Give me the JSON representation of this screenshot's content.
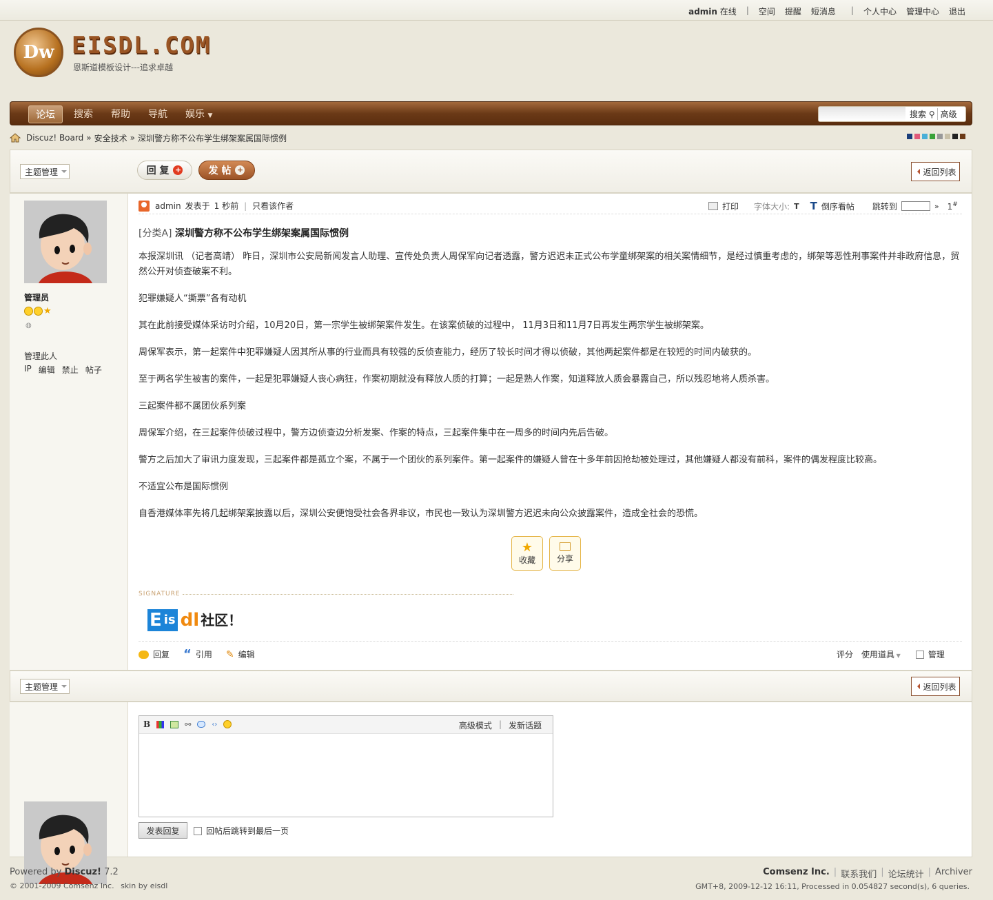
{
  "topbar": {
    "user": "admin",
    "status": "在线",
    "links": [
      "空间",
      "提醒",
      "短消息"
    ],
    "links2": [
      "个人中心",
      "管理中心",
      "退出"
    ]
  },
  "header": {
    "logo_mark": "Dw",
    "logo_text": "EISDL.COM",
    "slogan": "恩斯道模板设计---追求卓越"
  },
  "nav": {
    "items": [
      "论坛",
      "搜索",
      "帮助",
      "导航",
      "娱乐"
    ],
    "search_button": "搜索",
    "advanced": "高级"
  },
  "breadcrumb": {
    "items": [
      "Discuz! Board",
      "安全技术",
      "深圳警方称不公布学生绑架案属国际惯例"
    ]
  },
  "swatches": [
    "#1a3e7a",
    "#e05a7a",
    "#4ab0d8",
    "#3aa33a",
    "#999999",
    "#c8c0a8",
    "#222222",
    "#6b3a17"
  ],
  "toolbar": {
    "topic_manage": "主题管理",
    "reply": "回 复",
    "new_post": "发 帖",
    "back": "返回列表"
  },
  "author": {
    "role": "管理员",
    "manage_label": "管理此人",
    "manage_links": [
      "IP",
      "编辑",
      "禁止",
      "帖子"
    ]
  },
  "post": {
    "author": "admin",
    "posted": "发表于",
    "time": "1 秒前",
    "only_author": "只看该作者",
    "print": "打印",
    "font_size": "字体大小:",
    "reverse": "倒序看帖",
    "jump": "跳转到",
    "floor": "1",
    "floor_mark": "#",
    "category": "[分类A]",
    "title": "深圳警方称不公布学生绑架案属国际惯例",
    "paragraphs": [
      "本报深圳讯 （记者高靖） 昨日，深圳市公安局新闻发言人助理、宣传处负责人周保军向记者透露，警方迟迟未正式公布学童绑架案的相关案情细节，是经过慎重考虑的，绑架等恶性刑事案件并非政府信息，贸然公开对侦查破案不利。",
      "犯罪嫌疑人“撕票”各有动机",
      "其在此前接受媒体采访时介绍，10月20日，第一宗学生被绑架案件发生。在该案侦破的过程中， 11月3日和11月7日再发生两宗学生被绑架案。",
      "周保军表示，第一起案件中犯罪嫌疑人因其所从事的行业而具有较强的反侦查能力，经历了较长时间才得以侦破，其他两起案件都是在较短的时间内破获的。",
      "至于两名学生被害的案件，一起是犯罪嫌疑人丧心病狂，作案初期就没有释放人质的打算；一起是熟人作案，知道释放人质会暴露自己，所以残忍地将人质杀害。",
      "三起案件都不属团伙系列案",
      "周保军介绍，在三起案件侦破过程中，警方边侦查边分析发案、作案的特点，三起案件集中在一周多的时间内先后告破。",
      "警方之后加大了审讯力度发现，三起案件都是孤立个案，不属于一个团伙的系列案件。第一起案件的嫌疑人曾在十多年前因抢劫被处理过，其他嫌疑人都没有前科，案件的偶发程度比较高。",
      "不适宜公布是国际惯例",
      "自香港媒体率先将几起绑架案披露以后，深圳公安便饱受社会各界非议，市民也一致认为深圳警方迟迟未向公众披露案件，造成全社会的恐慌。"
    ],
    "favorite": "收藏",
    "share": "分享",
    "signature_label": "SIGNATURE",
    "sig_E": "E",
    "sig_is": "is",
    "sig_dl": "dl",
    "sig_text": "社区！",
    "actions": [
      "回复",
      "引用",
      "编辑"
    ],
    "rate": "评分",
    "tools": "使用道具",
    "manage": "管理"
  },
  "editor": {
    "advanced_mode": "高级模式",
    "new_topic": "发新话题",
    "submit": "发表回复",
    "jump_last": "回帖后跳转到最后一页"
  },
  "footer": {
    "powered": "Powered by",
    "brand": "Discuz!",
    "version": "7.2",
    "copyright": "© 2001-2009 Comsenz Inc.",
    "skin": "skin by eisdl",
    "company": "Comsenz Inc.",
    "links": [
      "联系我们",
      "论坛统计",
      "Archiver"
    ],
    "stats": "GMT+8, 2009-12-12 16:11, Processed in 0.054827 second(s), 6 queries."
  }
}
